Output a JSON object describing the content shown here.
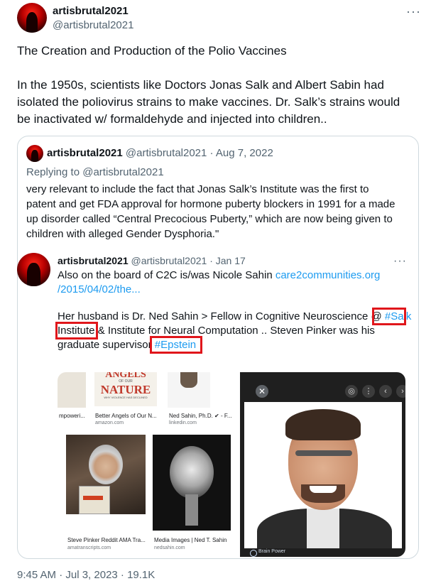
{
  "tweet": {
    "author_name": "artisbrutal2021",
    "author_handle": "@artisbrutal2021",
    "more_icon": "more-horizontal-icon",
    "line1": "The Creation and Production of the Polio Vaccines",
    "para2_l1": "In the 1950s, scientists like Doctors Jonas Salk and Albert Sabin had",
    "para2_l2": "isolated the poliovirus strains to make vaccines. Dr. Salk’s strains would",
    "para2_l3": "be inactivated w/ formaldehyde and injected into children.."
  },
  "quote": {
    "author_name": "artisbrutal2021",
    "author_handle": "@artisbrutal2021",
    "date": "· Aug 7, 2022",
    "replying_prefix": "Replying to ",
    "replying_handle": "@artisbrutal2021",
    "l1": "very relevant to include the fact that Jonas Salk’s Institute was the first to",
    "l2": "patent and get FDA approval for hormone puberty blockers in 1991 for a made",
    "l3": "up disorder called “Central Precocious Puberty,” which are now being given to",
    "l4": "children with alleged Gender Dysphoria.\""
  },
  "inner": {
    "author_name": "artisbrutal2021",
    "author_handle": "@artisbrutal2021",
    "date": "· Jan 17",
    "l1": "Also on the board of C2C is/was Nicole Sahin ",
    "link1": "care2communities.org",
    "link2": "/2015/04/02/the...",
    "l3a": "Her husband is Dr. Ned Sahin >  Fellow in Cognitive Neuroscience @ ",
    "hashtag_salk": "#Salk",
    "institute": "Institute",
    "l4b": " & Institute for Neural Computation .. Steven Pinker was his",
    "l5a": "graduate supervisor ",
    "hashtag_epstein": "#Epstein"
  },
  "image": {
    "book_title_1": "ANGELS",
    "book_title_2": "OF OUR",
    "book_title_3": "NATURE",
    "book_sub": "WHY VIOLENCE HAS DECLINED",
    "cap_left": "mpoweri...",
    "cap1": "Better Angels of Our N...",
    "src1": "amazon.com",
    "cap2": "Ned Sahin, Ph.D. ✔ - F...",
    "src2": "linkedin.com",
    "cap3": "Steve Pinker Reddit AMA Tra...",
    "src3": "amatranscripts.com",
    "cap4": "Media Images | Ned T. Sahin",
    "src4": "nedsahin.com",
    "brand": "Brain Power"
  },
  "footer": {
    "partial": "9:45 AM · Jul 3, 2023 · 19.1K"
  },
  "colors": {
    "link": "#1d9bf0",
    "muted": "#536471",
    "highlight_box": "#e0161b"
  }
}
